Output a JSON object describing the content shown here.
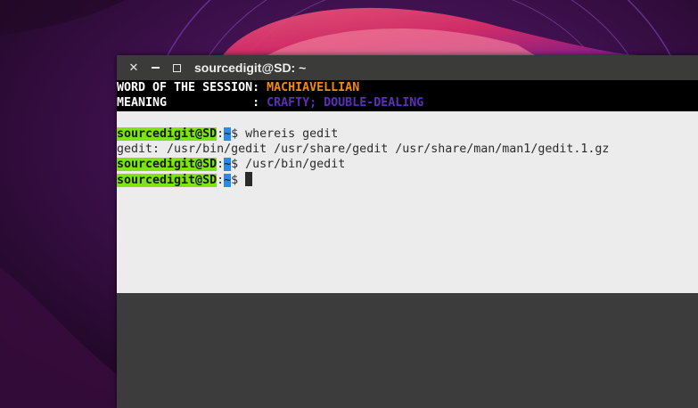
{
  "window": {
    "title": "sourcedigit@SD: ~"
  },
  "colors": {
    "accent_orange": "#f08a16",
    "accent_purple": "#5b2fb8",
    "prompt_green": "#7ce314",
    "path_blue": "#2a8ae8"
  },
  "terminal": {
    "banner": {
      "word_label": "WORD OF THE SESSION: ",
      "word_value": "MACHIAVELLIAN",
      "meaning_label": "MEANING            : ",
      "meaning_value": "CRAFTY; DOUBLE-DEALING"
    },
    "prompt": {
      "host": "sourcedigit@SD",
      "sep": ":",
      "path": "~",
      "sym": "$ "
    },
    "lines": {
      "cmd1": "whereis gedit",
      "out1": "gedit: /usr/bin/gedit /usr/share/gedit /usr/share/man/man1/gedit.1.gz",
      "cmd2": "/usr/bin/gedit"
    }
  }
}
